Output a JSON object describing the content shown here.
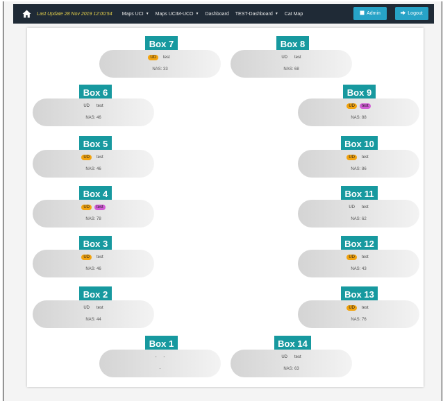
{
  "navbar": {
    "last_update": "Last Update 28 Nov 2019 12:00:54",
    "items": [
      {
        "label": "Maps UCI",
        "dropdown": true
      },
      {
        "label": "Maps UCIM-UCO",
        "dropdown": true
      },
      {
        "label": "Dashboard",
        "dropdown": false
      },
      {
        "label": "TEST-Dashboard",
        "dropdown": true
      },
      {
        "label": "Cat Map",
        "dropdown": false
      }
    ],
    "admin_label": "Admin",
    "logout_label": "Logout"
  },
  "boxes": [
    {
      "title": "Box 7",
      "ud": "UD",
      "test": "test",
      "nas": "NAS: 33",
      "ud_active": true,
      "test_active": false
    },
    {
      "title": "Box 8",
      "ud": "UD",
      "test": "test",
      "nas": "NAS: 68",
      "ud_active": false,
      "test_active": false
    },
    {
      "title": "Box 6",
      "ud": "UD",
      "test": "test",
      "nas": "NAS: 46",
      "ud_active": false,
      "test_active": false
    },
    {
      "title": "Box 9",
      "ud": "UD",
      "test": "test",
      "nas": "NAS: 88",
      "ud_active": true,
      "test_active": true
    },
    {
      "title": "Box 5",
      "ud": "UD",
      "test": "test",
      "nas": "NAS: 46",
      "ud_active": true,
      "test_active": false
    },
    {
      "title": "Box 10",
      "ud": "UD",
      "test": "test",
      "nas": "NAS: 86",
      "ud_active": true,
      "test_active": false
    },
    {
      "title": "Box 4",
      "ud": "UD",
      "test": "test",
      "nas": "NAS: 78",
      "ud_active": true,
      "test_active": true
    },
    {
      "title": "Box 11",
      "ud": "UD",
      "test": "test",
      "nas": "NAS: 62",
      "ud_active": false,
      "test_active": false
    },
    {
      "title": "Box 3",
      "ud": "UD",
      "test": "test",
      "nas": "NAS: 46",
      "ud_active": true,
      "test_active": false
    },
    {
      "title": "Box 12",
      "ud": "UD",
      "test": "test",
      "nas": "NAS: 43",
      "ud_active": true,
      "test_active": false
    },
    {
      "title": "Box 2",
      "ud": "UD",
      "test": "test",
      "nas": "NAS: 44",
      "ud_active": false,
      "test_active": false
    },
    {
      "title": "Box 13",
      "ud": "UD",
      "test": "test",
      "nas": "NAS: 76",
      "ud_active": true,
      "test_active": false
    },
    {
      "title": "Box 1",
      "ud": "-",
      "test": "-",
      "nas": "-",
      "ud_active": false,
      "test_active": false
    },
    {
      "title": "Box 14",
      "ud": "UD",
      "test": "test",
      "nas": "NAS: 63",
      "ud_active": false,
      "test_active": false
    }
  ],
  "colors": {
    "navbar": "#1f2a36",
    "accent": "#17999f",
    "button": "#27a3c7",
    "ud_active": "#f2a30f",
    "test_active": "#d25cd6",
    "last_update_text": "#e7d24b"
  },
  "icons": {
    "home": "home-icon",
    "admin": "user-icon",
    "logout": "logout-arrow-icon"
  }
}
